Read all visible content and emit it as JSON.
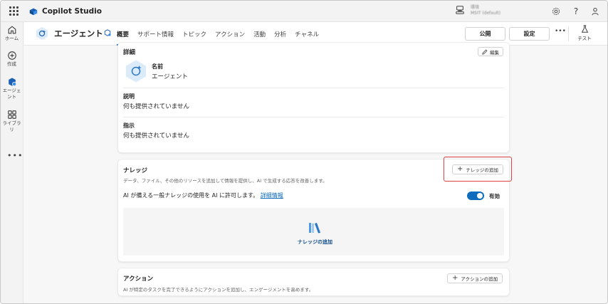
{
  "app": {
    "name": "Copilot Studio",
    "environment_line1": "環境",
    "environment_line2": "MSIT (default)"
  },
  "rail": {
    "items": [
      {
        "label": "ホーム",
        "icon": "home-icon"
      },
      {
        "label": "作成",
        "icon": "plus-circle-icon"
      },
      {
        "label": "エージェント",
        "icon": "agent-icon"
      },
      {
        "label": "ライブラリ",
        "icon": "library-icon"
      }
    ],
    "more": "•••"
  },
  "header": {
    "agent_name": "エージェント",
    "tabs": [
      "概要",
      "サポート情報",
      "トピック",
      "アクション",
      "活動",
      "分析",
      "チャネル"
    ],
    "active_tab": "概要",
    "publish_label": "公開",
    "settings_label": "設定",
    "more_label": "•••",
    "test_label": "テスト"
  },
  "details": {
    "title": "詳細",
    "edit_label": "編集",
    "name_label": "名前",
    "name_value": "エージェント",
    "description_label": "説明",
    "description_value": "何も提供されていません",
    "instructions_label": "指示",
    "instructions_value": "何も提供されていません"
  },
  "knowledge": {
    "title": "ナレッジ",
    "description": "データ、ファイル、その他のリソースを追加して情報を提供し、AI で生成する応答を改善します。",
    "add_label": "ナレッジの追加",
    "ai_text": "AI が備える一般ナレッジの使用を AI に許可します。",
    "ai_link": "詳細情報",
    "toggle_label": "有効",
    "toggle_on": true,
    "empty_label": "ナレッジの追加"
  },
  "actions": {
    "title": "アクション",
    "description": "AI が特定のタスクを完了できるようにアクションを追加し、エンゲージメントを高めます。",
    "add_label": "アクションの追加"
  },
  "colors": {
    "accent": "#0f6cbd",
    "highlight": "#e0424a"
  }
}
